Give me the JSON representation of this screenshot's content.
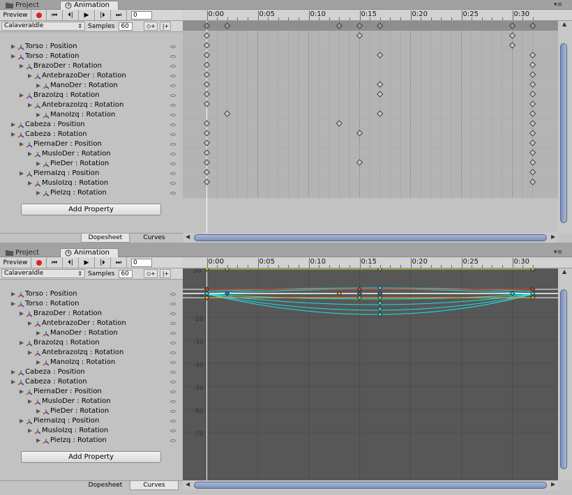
{
  "top": {
    "tabs": [
      {
        "label": "Project",
        "icon": "folder-icon"
      },
      {
        "label": "Animation",
        "icon": "clock-icon"
      }
    ],
    "toolbar": {
      "preview_label": "Preview",
      "frame_value": "0",
      "clip_name": "CalaveraIdle",
      "samples_label": "Samples",
      "samples_value": "60"
    },
    "timeline": {
      "labels": [
        "0:00",
        "0:05",
        "0:10",
        "0:15",
        "0:20",
        "0:25",
        "0:30"
      ]
    },
    "properties": [
      {
        "label": "Torso : Position"
      },
      {
        "label": "Torso : Rotation"
      },
      {
        "label": "BrazoDer : Rotation"
      },
      {
        "label": "AntebrazoDer : Rotation"
      },
      {
        "label": "ManoDer : Rotation"
      },
      {
        "label": "BrazoIzq : Rotation"
      },
      {
        "label": "AntebrazoIzq : Rotation"
      },
      {
        "label": "ManoIzq : Rotation"
      },
      {
        "label": "Cabeza : Position"
      },
      {
        "label": "Cabeza : Rotation"
      },
      {
        "label": "PiernaDer : Position"
      },
      {
        "label": "MusloDer : Rotation"
      },
      {
        "label": "PieDer : Rotation"
      },
      {
        "label": "PiernaIzq : Position"
      },
      {
        "label": "MusloIzq : Rotation"
      },
      {
        "label": "PieIzq : Rotation"
      }
    ],
    "add_property_label": "Add Property",
    "bottom_tabs": [
      "Dopesheet",
      "Curves"
    ]
  },
  "bottom": {
    "tabs": [
      {
        "label": "Project",
        "icon": "folder-icon"
      },
      {
        "label": "Animation",
        "icon": "clock-icon"
      }
    ],
    "toolbar": {
      "preview_label": "Preview",
      "frame_value": "0",
      "clip_name": "CalaveraIdle",
      "samples_label": "Samples",
      "samples_value": "60"
    },
    "timeline": {
      "labels": [
        "0:00",
        "0:05",
        "0:10",
        "0:15",
        "0:20",
        "0:25",
        "0:30"
      ]
    },
    "properties": [
      {
        "label": "Torso : Position"
      },
      {
        "label": "Torso : Rotation"
      },
      {
        "label": "BrazoDer : Rotation"
      },
      {
        "label": "AntebrazoDer : Rotation"
      },
      {
        "label": "ManoDer : Rotation"
      },
      {
        "label": "BrazoIzq : Rotation"
      },
      {
        "label": "AntebrazoIzq : Rotation"
      },
      {
        "label": "ManoIzq : Rotation"
      },
      {
        "label": "Cabeza : Position"
      },
      {
        "label": "Cabeza : Rotation"
      },
      {
        "label": "PiernaDer : Position"
      },
      {
        "label": "MusloDer : Rotation"
      },
      {
        "label": "PieDer : Rotation"
      },
      {
        "label": "PiernaIzq : Position"
      },
      {
        "label": "MusloIzq : Rotation"
      },
      {
        "label": "PieIzq : Rotation"
      }
    ],
    "add_property_label": "Add Property",
    "bottom_tabs": [
      "Dopesheet",
      "Curves"
    ],
    "curve_axis_labels": [
      "10",
      "-10",
      "-20",
      "-30",
      "-40",
      "-50",
      "-60",
      "-70"
    ]
  },
  "dopesheet_keys": {
    "summary": [
      "0:00",
      "0:02",
      "0:13",
      "0:15",
      "0:17",
      "0:30",
      "0:32"
    ],
    "rows": [
      [
        "0:00",
        "0:15",
        "0:30"
      ],
      [
        "0:00",
        "0:30"
      ],
      [
        "0:00",
        "0:17",
        "0:32"
      ],
      [
        "0:00",
        "0:32"
      ],
      [
        "0:00",
        "0:32"
      ],
      [
        "0:00",
        "0:17",
        "0:32"
      ],
      [
        "0:00",
        "0:17",
        "0:32"
      ],
      [
        "0:00",
        "0:32"
      ],
      [
        "0:02",
        "0:17",
        "0:32"
      ],
      [
        "0:00",
        "0:13",
        "0:32"
      ],
      [
        "0:00",
        "0:15",
        "0:32"
      ],
      [
        "0:00",
        "0:32"
      ],
      [
        "0:00",
        "0:32"
      ],
      [
        "0:00",
        "0:15",
        "0:32"
      ],
      [
        "0:00",
        "0:32"
      ],
      [
        "0:00",
        "0:32"
      ]
    ]
  },
  "colors": {
    "curve_green": "#9acd32",
    "curve_cyan": "#19e3e3",
    "curve_red": "#e0402a",
    "curve_orange": "#f0a030",
    "curve_white": "#ffffff",
    "curve_blue": "#4466ff"
  }
}
